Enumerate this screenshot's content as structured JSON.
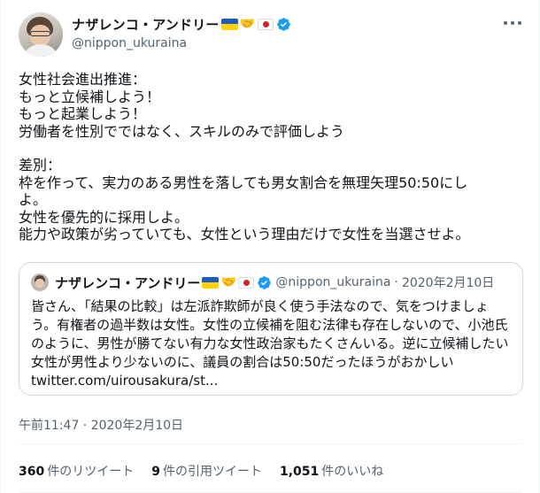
{
  "tweet": {
    "display_name": "ナザレンコ・アンドリー",
    "handle": "@nippon_ukuraina",
    "body_lines": [
      "女性社会進出推進：",
      "もっと立候補しよう！",
      "もっと起業しよう！",
      "労働者を性別でではなく、スキルのみで評価しよう"
    ],
    "body_lines_2": [
      "差別：",
      "枠を作って、実力のある男性を落しても男女割合を無理矢理50:50にし",
      "よ。",
      "女性を優先的に採用しよ。",
      "能力や政策が劣っていても、女性という理由だけで女性を当選させよ。"
    ],
    "timestamp": "午前11:47 · 2020年2月10日"
  },
  "quote": {
    "display_name": "ナザレンコ・アンドリー",
    "handle": "@nippon_ukuraina",
    "separator": "·",
    "date": "2020年2月10日",
    "text_lines": [
      "皆さん、「結果の比較」は左派詐欺師が良く使う手法なので、気をつけましょ",
      "う。有権者の過半数は女性。女性の立候補を阻む法律も存在しないので、小池氏",
      "のように、男性が勝てない有力な女性政治家もたくさんいる。逆に立候補したい",
      "女性が男性より少ないのに、議員の割合は50:50だったほうがおかしい",
      "twitter.com/uirousakura/st..."
    ]
  },
  "stats": {
    "retweets_count": "360",
    "retweets_label": "件のリツイート",
    "quotes_count": "9",
    "quotes_label": "件の引用ツイート",
    "likes_count": "1,051",
    "likes_label": "件のいいね"
  },
  "icons": {
    "verified": "verified-badge-icon",
    "more": "more-options-icon",
    "flag_ukraine": "ukraine-flag-icon",
    "handshake": "handshake-icon",
    "flag_japan": "japan-flag-icon"
  },
  "colors": {
    "text": "#0f1419",
    "secondary_text": "#536471",
    "verified_blue": "#1d9bf0",
    "border": "#cfd9de"
  }
}
